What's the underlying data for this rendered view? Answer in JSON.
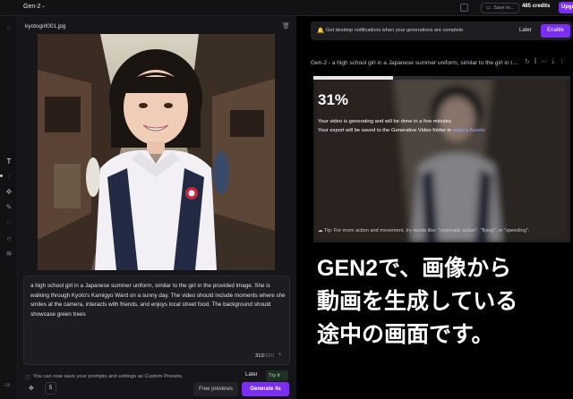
{
  "header": {
    "app_title": "Gen-2",
    "save_label": "Save in...",
    "credits": "485 credits",
    "upgrade_label": "Upgrade"
  },
  "left_rail": {
    "icons": [
      "circle-icon",
      "text-icon",
      "sliders-icon",
      "motion-icon",
      "brush-icon",
      "dotted-circle-icon",
      "dashed-circle-icon",
      "layers-icon"
    ],
    "bottom_label": "-16"
  },
  "left": {
    "file_name": "kyotogirl001.jpg",
    "prompt": "a high school girl in a Japanese summer uniform, similar to the girl in the provided image. She is walking through Kyoto's Kamigyo Ward on a sunny day. The video should include moments where she smiles at the camera, interacts with friends, and enjoys local street food. The background should showcase green trees",
    "char_count": "313",
    "char_limit": "/320",
    "preset_message": "You can now save your prompts and settings as Custom Presets.",
    "preset_later": "Later",
    "preset_try": "Try it",
    "motion_count": "5",
    "free_previews": "Free previews",
    "generate": "Generate 4s"
  },
  "right": {
    "notification": "Get desktop notifications when your generations are complete.",
    "notif_later": "Later",
    "notif_enable": "Enable",
    "gen_title": "Gen-2 - a high school girl in a Japanese summer uniform, similar to the girl in the provided image",
    "progress_percent": 31,
    "percent_label": "31%",
    "status_line1": "Your video is generating and will be done in a few minutes",
    "status_line2_pre": "Your export will be saved to the Generative Video folder in ",
    "status_line2_link": "mikio's Assets",
    "tip": "Tip: For more action and movement, try words like: \"cinematic action\", \"flying\", or \"speeding\"."
  },
  "overlay": {
    "line1": "GEN2で、画像から",
    "line2": "動画を生成している",
    "line3": "途中の画面です。"
  }
}
